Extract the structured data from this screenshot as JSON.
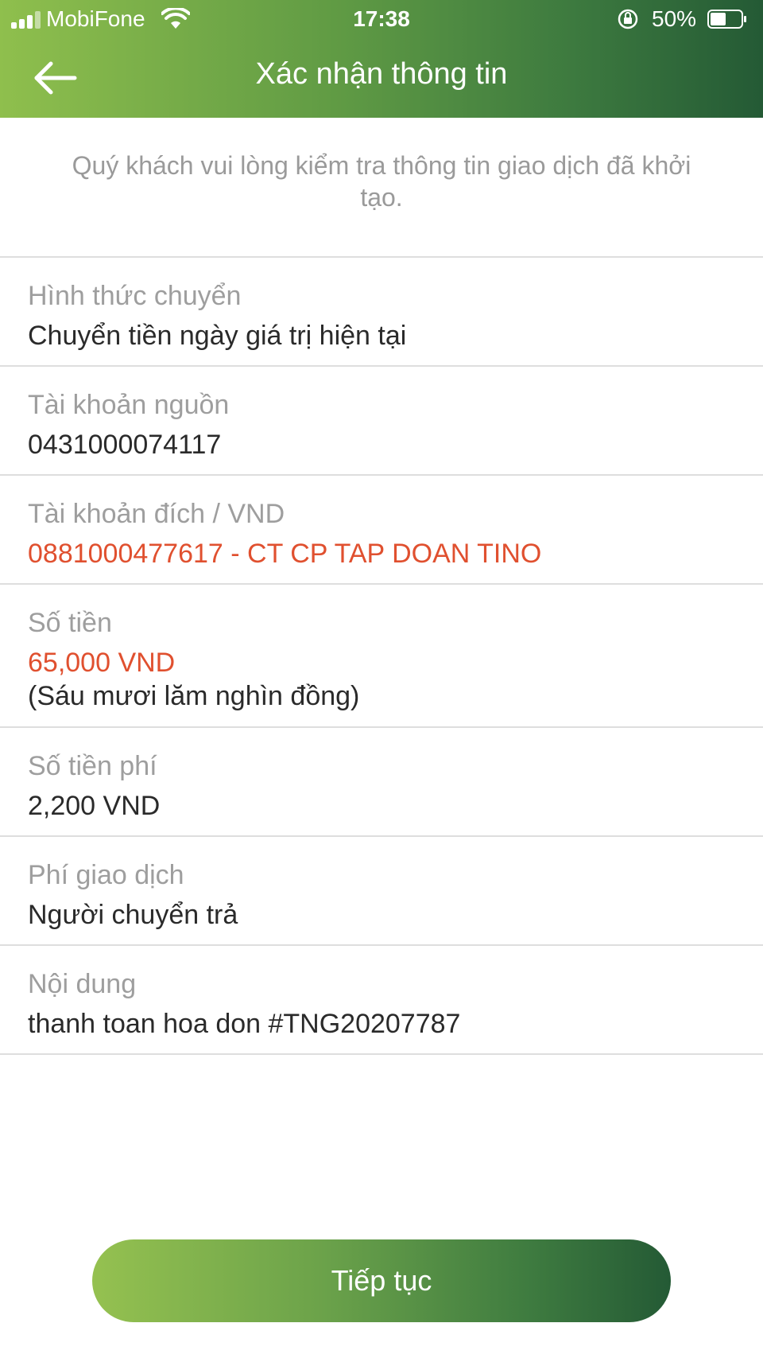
{
  "status_bar": {
    "carrier": "MobiFone",
    "time": "17:38",
    "battery_percent": "50%"
  },
  "header": {
    "title": "Xác nhận thông tin",
    "back_icon": "arrow-left-icon"
  },
  "intro_text": "Quý khách vui lòng kiểm tra thông tin giao dịch đã khởi tạo.",
  "fields": [
    {
      "label": "Hình thức chuyển",
      "value": "Chuyển tiền ngày giá trị hiện tại"
    },
    {
      "label": "Tài khoản nguồn",
      "value": "0431000074117"
    },
    {
      "label": "Tài khoản đích / VND",
      "value": "0881000477617 - CT CP TAP DOAN TINO"
    },
    {
      "label": "Số tiền",
      "value": "65,000 VND",
      "sub_value": "(Sáu mươi lăm nghìn đồng)"
    },
    {
      "label": "Số tiền phí",
      "value": "2,200 VND"
    },
    {
      "label": "Phí giao dịch",
      "value": "Người chuyển trả"
    },
    {
      "label": "Nội dung",
      "value": "thanh toan hoa don #TNG20207787"
    }
  ],
  "continue_button": {
    "label": "Tiếp tục"
  },
  "colors": {
    "header_gradient_start": "#8fbf4d",
    "header_gradient_end": "#245a35",
    "highlight_red": "#e0502f",
    "label_gray": "#9e9e9e"
  }
}
